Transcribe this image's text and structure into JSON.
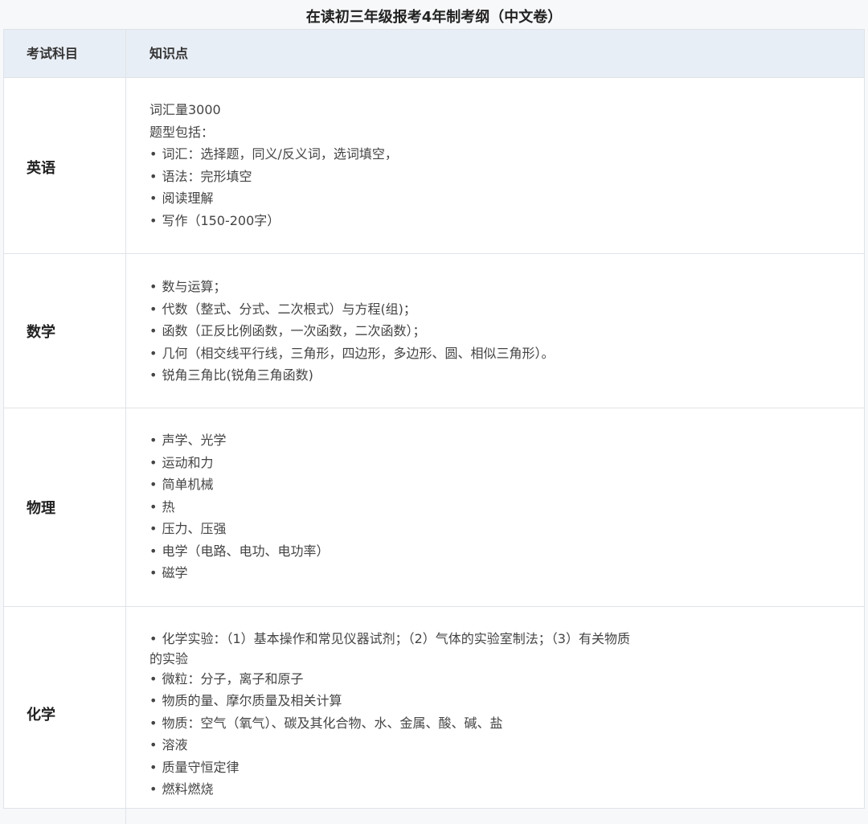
{
  "title": "在读初三年级报考4年制考纲（中文卷）",
  "header": {
    "col1": "考试科目",
    "col2": "知识点"
  },
  "rows": [
    {
      "subject": "英语",
      "lines": [
        {
          "text": "词汇量3000",
          "bullet": false
        },
        {
          "text": "题型包括：",
          "bullet": false
        },
        {
          "text": "词汇：选择题，同义/反义词，选词填空，",
          "bullet": true
        },
        {
          "text": "语法：完形填空",
          "bullet": true
        },
        {
          "text": "阅读理解",
          "bullet": true
        },
        {
          "text": "写作（150-200字）",
          "bullet": true
        }
      ]
    },
    {
      "subject": "数学",
      "lines": [
        {
          "text": "数与运算；",
          "bullet": true
        },
        {
          "text": "代数（整式、分式、二次根式）与方程(组)；",
          "bullet": true
        },
        {
          "text": "函数（正反比例函数，一次函数，二次函数）；",
          "bullet": true
        },
        {
          "text": "几何（相交线平行线，三角形，四边形，多边形、圆、相似三角形）。",
          "bullet": true
        },
        {
          "text": "锐角三角比(锐角三角函数)",
          "bullet": true
        }
      ]
    },
    {
      "subject": "物理",
      "lines": [
        {
          "text": "声学、光学",
          "bullet": true
        },
        {
          "text": "运动和力",
          "bullet": true
        },
        {
          "text": "简单机械",
          "bullet": true
        },
        {
          "text": "热",
          "bullet": true
        },
        {
          "text": "压力、压强",
          "bullet": true
        },
        {
          "text": "电学（电路、电功、电功率）",
          "bullet": true
        },
        {
          "text": "磁学",
          "bullet": true
        }
      ]
    },
    {
      "subject": "化学",
      "lines": [
        {
          "text": "化学实验：（1）基本操作和常见仪器试剂；（2）气体的实验室制法；（3）有关物质",
          "bullet": true
        },
        {
          "text": "的实验",
          "bullet": false
        },
        {
          "text": "微粒：分子，离子和原子",
          "bullet": true
        },
        {
          "text": "物质的量、摩尔质量及相关计算",
          "bullet": true
        },
        {
          "text": "物质：空气（氧气）、碳及其化合物、水、金属、酸、碱、盐",
          "bullet": true
        },
        {
          "text": "溶液",
          "bullet": true
        },
        {
          "text": "质量守恒定律",
          "bullet": true
        },
        {
          "text": "燃料燃烧",
          "bullet": true
        }
      ]
    }
  ]
}
